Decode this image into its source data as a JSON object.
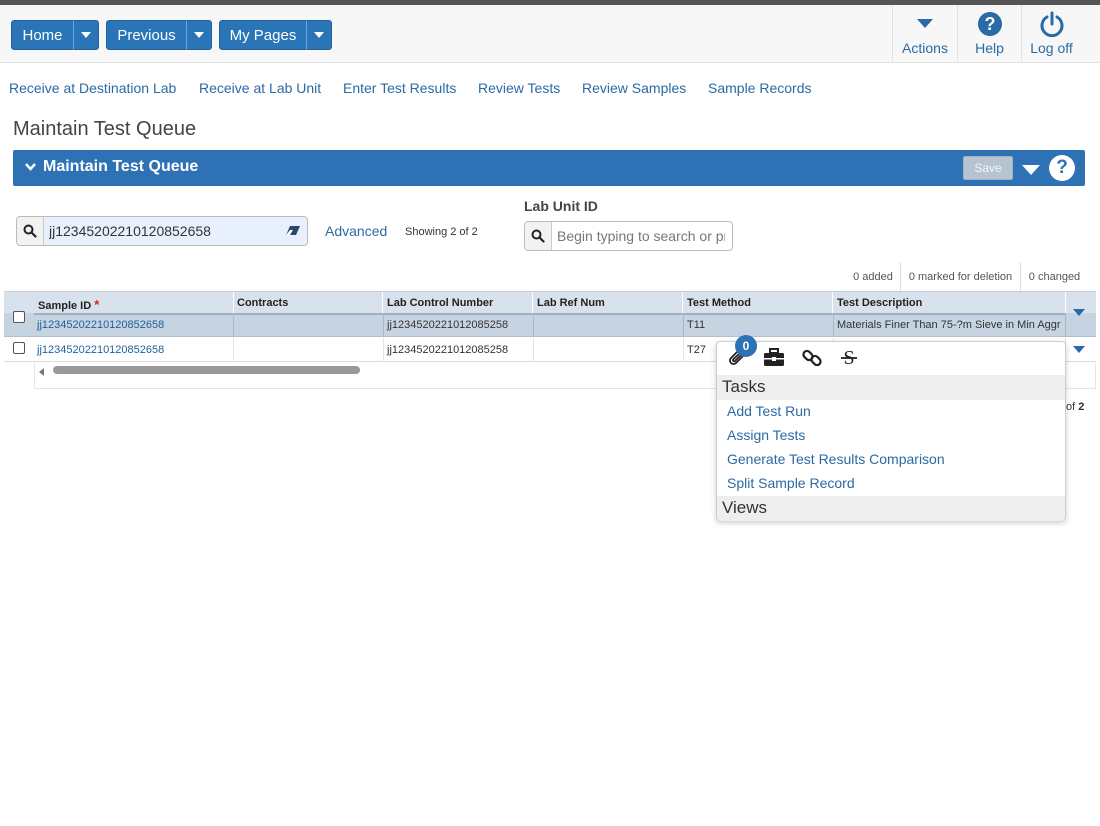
{
  "header": {
    "nav_buttons": [
      {
        "label": "Home"
      },
      {
        "label": "Previous"
      },
      {
        "label": "My Pages"
      }
    ],
    "actions": [
      {
        "label": "Actions",
        "icon": "caret-down-icon"
      },
      {
        "label": "Help",
        "icon": "help-circle-icon"
      },
      {
        "label": "Log off",
        "icon": "power-icon"
      }
    ]
  },
  "quick_links": [
    "Receive at Destination Lab",
    "Receive at Lab Unit",
    "Enter Test Results",
    "Review Tests",
    "Review Samples",
    "Sample Records"
  ],
  "page_title": "Maintain Test Queue",
  "panel": {
    "title": "Maintain Test Queue",
    "save_label": "Save",
    "help_label": "?"
  },
  "search": {
    "value": "jj12345202210120852658",
    "advanced_label": "Advanced",
    "showing_text": "Showing 2 of 2"
  },
  "lab_unit": {
    "label": "Lab Unit ID",
    "placeholder": "Begin typing to search or press"
  },
  "counts": {
    "added": "0 added",
    "marked": "0 marked for deletion",
    "changed": "0 changed"
  },
  "grid": {
    "columns": [
      "Sample ID",
      "Contracts",
      "Lab Control Number",
      "Lab Ref Num",
      "Test Method",
      "Test Description"
    ],
    "required_marker": "*",
    "rows": [
      {
        "sample_id": "jj12345202210120852658",
        "contracts": "",
        "lab_control": "jj1234520221012085258",
        "lab_ref": "",
        "test_method": "T11",
        "test_description": "Materials Finer Than 75-?m Sieve in Min Aggr"
      },
      {
        "sample_id": "jj12345202210120852658",
        "contracts": "",
        "lab_control": "jj1234520221012085258",
        "lab_ref": "",
        "test_method": "T27",
        "test_description": ""
      }
    ]
  },
  "pager": {
    "prefix": "of ",
    "total": "2"
  },
  "popup": {
    "badge_count": "0",
    "icons": [
      "paperclip-icon",
      "briefcase-icon",
      "link-icon",
      "strikethrough-icon"
    ],
    "tasks_header": "Tasks",
    "tasks": [
      "Add Test Run",
      "Assign Tests",
      "Generate Test Results Comparison",
      "Split Sample Record"
    ],
    "views_header": "Views"
  },
  "colors": {
    "primary_blue": "#2a74b8",
    "panel_blue": "#2e72b5",
    "link_blue": "#2a6aa5",
    "selected_row": "#c6d4e2"
  }
}
